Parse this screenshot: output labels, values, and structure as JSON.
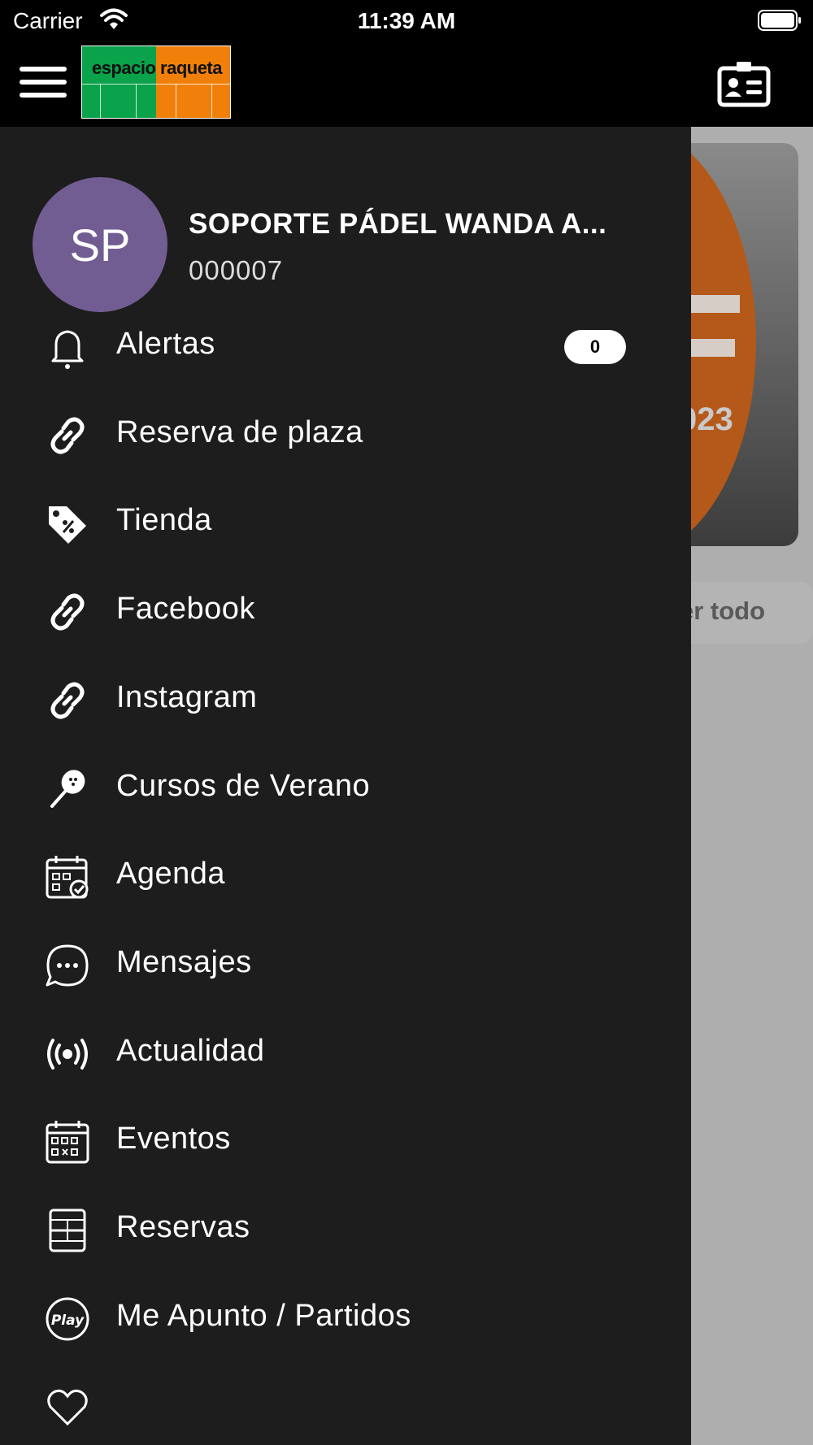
{
  "status_bar": {
    "carrier": "Carrier",
    "time": "11:39 AM"
  },
  "app_bar": {
    "logo_text": "espacio raqueta",
    "colors": {
      "logo_green": "#0aa24a",
      "logo_orange": "#f0800a"
    }
  },
  "drawer": {
    "background": "#1d1d1e",
    "user": {
      "initials": "SP",
      "name": "SOPORTE PÁDEL WANDA A...",
      "id": "000007",
      "avatar_color": "#725d93"
    },
    "items": [
      {
        "label": "Alertas",
        "icon": "bell-icon",
        "badge": "0"
      },
      {
        "label": "Reserva de plaza",
        "icon": "link-icon"
      },
      {
        "label": "Tienda",
        "icon": "tag-icon"
      },
      {
        "label": "Facebook",
        "icon": "link-icon"
      },
      {
        "label": "Instagram",
        "icon": "link-icon"
      },
      {
        "label": "Cursos de Verano",
        "icon": "racket-icon"
      },
      {
        "label": "Agenda",
        "icon": "calendar-check-icon"
      },
      {
        "label": "Mensajes",
        "icon": "chat-icon"
      },
      {
        "label": "Actualidad",
        "icon": "broadcast-icon"
      },
      {
        "label": "Eventos",
        "icon": "calendar-grid-icon"
      },
      {
        "label": "Reservas",
        "icon": "court-icon"
      },
      {
        "label": "Me Apunto / Partidos",
        "icon": "play-icon"
      }
    ]
  },
  "background": {
    "year_partial": "023",
    "see_all_partial": "er todo"
  }
}
